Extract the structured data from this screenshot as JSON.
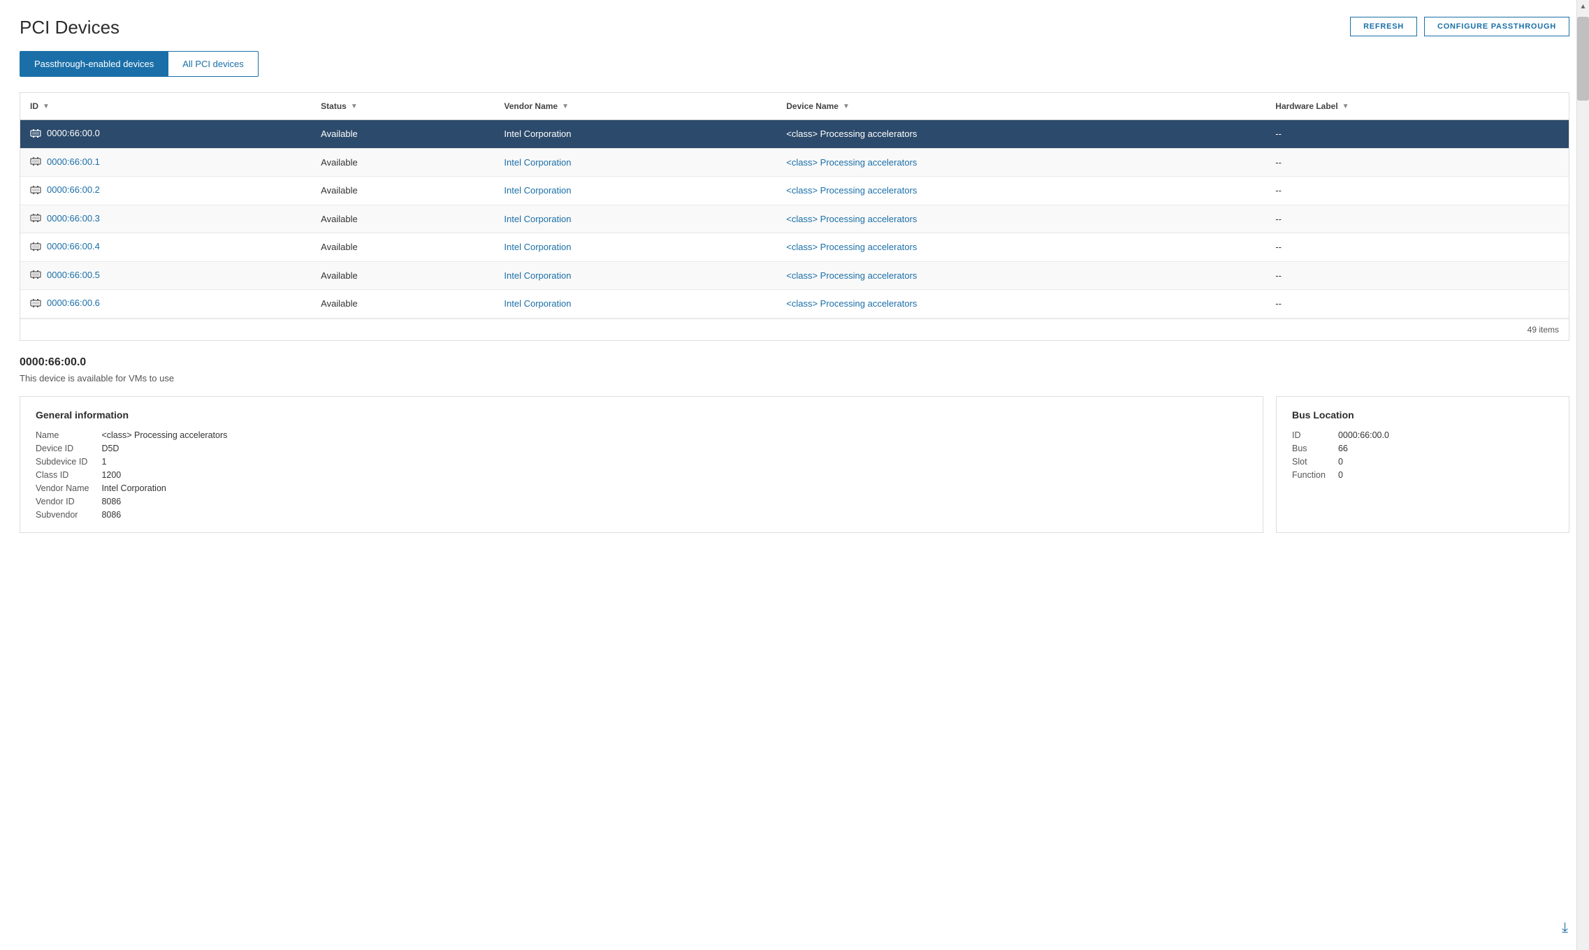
{
  "page": {
    "title": "PCI Devices"
  },
  "header_buttons": {
    "refresh": "REFRESH",
    "configure": "CONFIGURE PASSTHROUGH"
  },
  "tabs": [
    {
      "id": "passthrough",
      "label": "Passthrough-enabled devices",
      "active": true
    },
    {
      "id": "all",
      "label": "All PCI devices",
      "active": false
    }
  ],
  "table": {
    "columns": [
      {
        "id": "id",
        "label": "ID"
      },
      {
        "id": "status",
        "label": "Status"
      },
      {
        "id": "vendor_name",
        "label": "Vendor Name"
      },
      {
        "id": "device_name",
        "label": "Device Name"
      },
      {
        "id": "hardware_label",
        "label": "Hardware Label"
      }
    ],
    "rows": [
      {
        "id": "0000:66:00.0",
        "status": "Available",
        "vendor": "Intel Corporation",
        "device": "<class> Processing accelerators",
        "hardware_label": "--",
        "selected": true
      },
      {
        "id": "0000:66:00.1",
        "status": "Available",
        "vendor": "Intel Corporation",
        "device": "<class> Processing accelerators",
        "hardware_label": "--",
        "selected": false
      },
      {
        "id": "0000:66:00.2",
        "status": "Available",
        "vendor": "Intel Corporation",
        "device": "<class> Processing accelerators",
        "hardware_label": "--",
        "selected": false
      },
      {
        "id": "0000:66:00.3",
        "status": "Available",
        "vendor": "Intel Corporation",
        "device": "<class> Processing accelerators",
        "hardware_label": "--",
        "selected": false
      },
      {
        "id": "0000:66:00.4",
        "status": "Available",
        "vendor": "Intel Corporation",
        "device": "<class> Processing accelerators",
        "hardware_label": "--",
        "selected": false
      },
      {
        "id": "0000:66:00.5",
        "status": "Available",
        "vendor": "Intel Corporation",
        "device": "<class> Processing accelerators",
        "hardware_label": "--",
        "selected": false
      },
      {
        "id": "0000:66:00.6",
        "status": "Available",
        "vendor": "Intel Corporation",
        "device": "<class> Processing accelerators",
        "hardware_label": "--",
        "selected": false
      }
    ],
    "footer": "49 items"
  },
  "selected_device": {
    "id": "0000:66:00.0",
    "description": "This device is available for VMs to use"
  },
  "general_info": {
    "title": "General information",
    "fields": [
      {
        "label": "Name",
        "value": "<class> Processing accelerators"
      },
      {
        "label": "Device ID",
        "value": "D5D"
      },
      {
        "label": "Subdevice ID",
        "value": "1"
      },
      {
        "label": "Class ID",
        "value": "1200"
      },
      {
        "label": "Vendor Name",
        "value": "Intel Corporation"
      },
      {
        "label": "Vendor ID",
        "value": "8086"
      },
      {
        "label": "Subvendor",
        "value": "8086"
      }
    ]
  },
  "bus_location": {
    "title": "Bus Location",
    "fields": [
      {
        "label": "ID",
        "value": "0000:66:00.0"
      },
      {
        "label": "Bus",
        "value": "66"
      },
      {
        "label": "Slot",
        "value": "0"
      },
      {
        "label": "Function",
        "value": "0"
      }
    ]
  }
}
